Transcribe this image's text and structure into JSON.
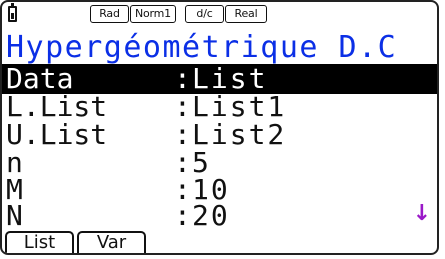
{
  "status_bar": {
    "battery_icon": "battery-icon",
    "angle_mode": "Rad",
    "display_mode": "Norm1",
    "fraction_mode": "d/c",
    "complex_mode": "Real"
  },
  "title": "Hypergéométrique D.C",
  "params": [
    {
      "label": "Data",
      "value": "List"
    },
    {
      "label": "L.List",
      "value": "List1"
    },
    {
      "label": "U.List",
      "value": "List2"
    },
    {
      "label": "n",
      "value": "5"
    },
    {
      "label": "M",
      "value": "10"
    },
    {
      "label": "N",
      "value": "20"
    }
  ],
  "separator": ":",
  "scroll_indicator": "↓",
  "function_keys": [
    {
      "label": "List"
    },
    {
      "label": "Var"
    }
  ],
  "colors": {
    "title": "#0b2fe6",
    "scroll_arrow": "#9a19c8",
    "selection_bg": "#000000"
  }
}
